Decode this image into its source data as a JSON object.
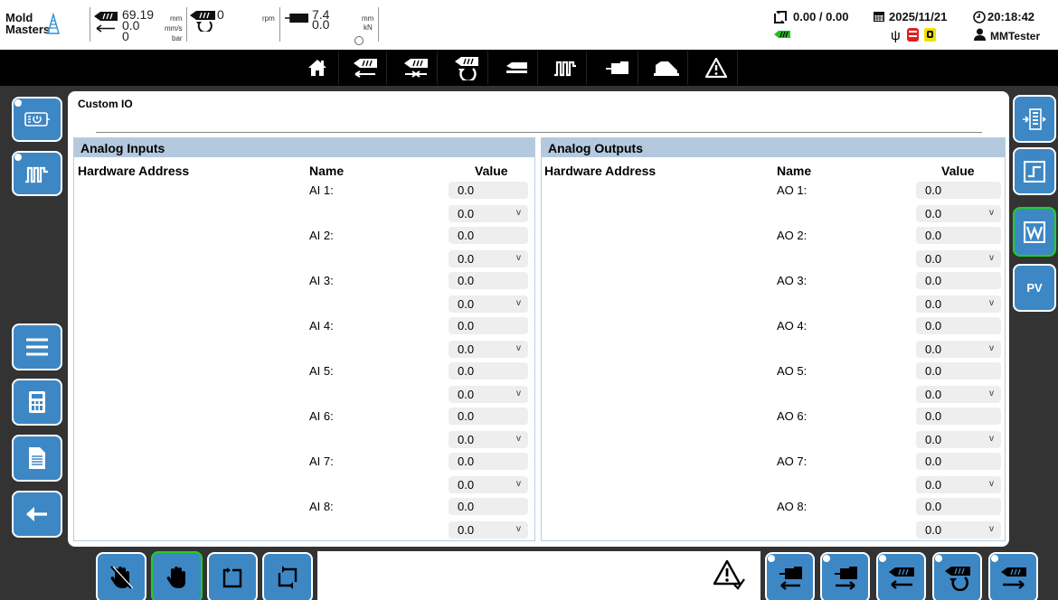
{
  "app": {
    "logo_line1": "Mold",
    "logo_line2": "Masters"
  },
  "status": {
    "injection_position": "69.19",
    "injection_position_unit": "mm",
    "injection_speed": "0.0",
    "injection_speed_unit": "mm/s",
    "injection_pressure": "0",
    "injection_pressure_unit": "bar",
    "screw_rotation": "0",
    "screw_rotation_unit": "rpm",
    "clamp_position": "7.4",
    "clamp_position_unit": "mm",
    "clamp_force": "0.0",
    "clamp_force_unit": "kN",
    "counter": "0.00 / 0.00",
    "date": "2025/11/21",
    "time": "20:18:42",
    "user": "MMTester"
  },
  "page": {
    "title": "Custom IO"
  },
  "analog_inputs": {
    "title": "Analog Inputs",
    "col_address": "Hardware Address",
    "col_name": "Name",
    "col_value": "Value",
    "rows": [
      {
        "name": "AI 1:",
        "value": "0.0",
        "select": "0.0",
        "chevron": "v"
      },
      {
        "name": "AI 2:",
        "value": "0.0",
        "select": "0.0",
        "chevron": "v"
      },
      {
        "name": "AI 3:",
        "value": "0.0",
        "select": "0.0",
        "chevron": "v"
      },
      {
        "name": "AI 4:",
        "value": "0.0",
        "select": "0.0",
        "chevron": "v"
      },
      {
        "name": "AI 5:",
        "value": "0.0",
        "select": "0.0",
        "chevron": "v"
      },
      {
        "name": "AI 6:",
        "value": "0.0",
        "select": "0.0",
        "chevron": "v"
      },
      {
        "name": "AI 7:",
        "value": "0.0",
        "select": "0.0",
        "chevron": "v"
      },
      {
        "name": "AI 8:",
        "value": "0.0",
        "select": "0.0",
        "chevron": "v"
      }
    ]
  },
  "analog_outputs": {
    "title": "Analog Outputs",
    "col_address": "Hardware Address",
    "col_name": "Name",
    "col_value": "Value",
    "rows": [
      {
        "name": "AO 1:",
        "value": "0.0",
        "select": "0.0",
        "chevron": "v"
      },
      {
        "name": "AO 2:",
        "value": "0.0",
        "select": "0.0",
        "chevron": "v"
      },
      {
        "name": "AO 3:",
        "value": "0.0",
        "select": "0.0",
        "chevron": "v"
      },
      {
        "name": "AO 4:",
        "value": "0.0",
        "select": "0.0",
        "chevron": "v"
      },
      {
        "name": "AO 5:",
        "value": "0.0",
        "select": "0.0",
        "chevron": "v"
      },
      {
        "name": "AO 6:",
        "value": "0.0",
        "select": "0.0",
        "chevron": "v"
      },
      {
        "name": "AO 7:",
        "value": "0.0",
        "select": "0.0",
        "chevron": "v"
      },
      {
        "name": "AO 8:",
        "value": "0.0",
        "select": "0.0",
        "chevron": "v"
      }
    ]
  },
  "right_sidebar": {
    "pv_label": "PV"
  },
  "colors": {
    "accent_blue": "#3e87c5",
    "section_header": "#b4c9dd",
    "active_green": "#20d020",
    "background": "#333333"
  }
}
